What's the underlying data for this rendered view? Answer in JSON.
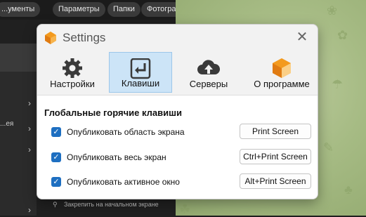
{
  "background": {
    "chips": [
      "...ументы",
      "Параметры",
      "Папки",
      "Фотографии"
    ],
    "side_text": "...ея",
    "bottom_item": "Закрепить на начальном экране"
  },
  "dialog": {
    "title": "Settings",
    "close": "✕",
    "tabs": [
      {
        "label": "Настройки",
        "icon": "gear-icon",
        "active": false
      },
      {
        "label": "Клавиши",
        "icon": "enter-key-icon",
        "active": true
      },
      {
        "label": "Серверы",
        "icon": "cloud-upload-icon",
        "active": false
      },
      {
        "label": "О программе",
        "icon": "app-logo-icon",
        "active": false
      }
    ],
    "section_title": "Глобальные горячие клавиши",
    "hotkeys": [
      {
        "label": "Опубликовать область экрана",
        "key": "Print Screen",
        "checked": true
      },
      {
        "label": "Опубликовать весь экран",
        "key": "Ctrl+Print Screen",
        "checked": true
      },
      {
        "label": "Опубликовать активное окно",
        "key": "Alt+Print Screen",
        "checked": true
      }
    ]
  },
  "colors": {
    "accent": "#1e6fc1",
    "active_tab": "#cce4f7",
    "logo_orange": "#f39a1e"
  }
}
